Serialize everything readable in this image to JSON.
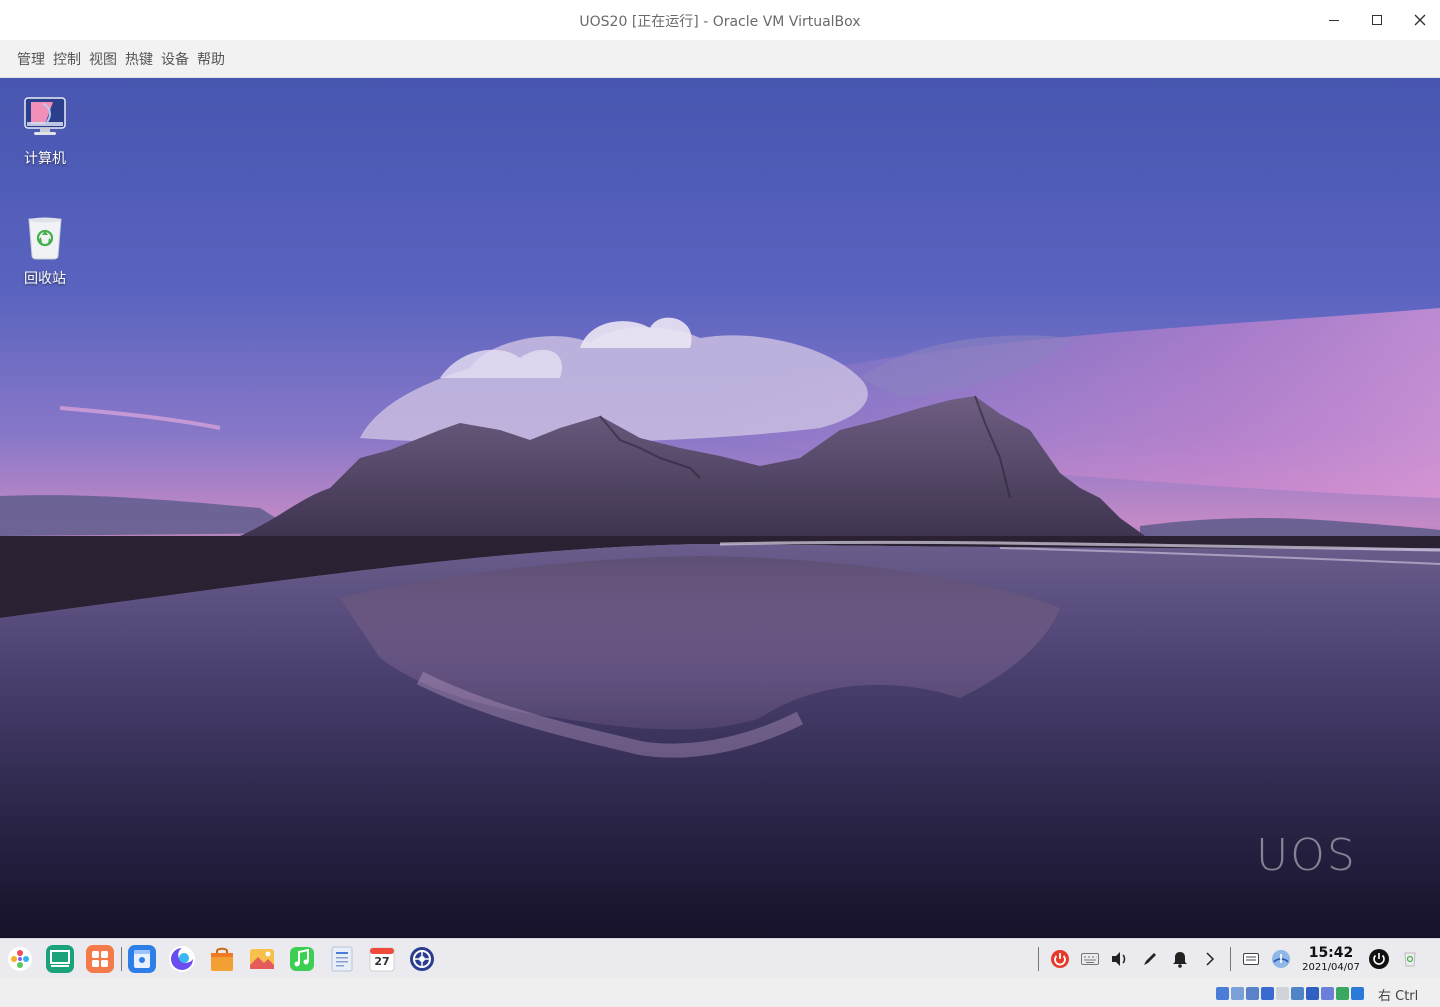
{
  "window": {
    "title": "UOS20 [正在运行] - Oracle VM VirtualBox"
  },
  "menu": {
    "items": [
      "管理",
      "控制",
      "视图",
      "热键",
      "设备",
      "帮助"
    ]
  },
  "desktop": {
    "icons": [
      {
        "label": "计算机",
        "icon": "computer-icon"
      },
      {
        "label": "回收站",
        "icon": "trash-icon"
      }
    ],
    "watermark": "UOS"
  },
  "dock": {
    "apps": [
      {
        "name": "launcher",
        "icon": "launcher-icon",
        "color": "#ffffff"
      },
      {
        "name": "multitask-view",
        "icon": "multitask-view-icon",
        "color": "#1aa37a"
      },
      {
        "name": "app-store",
        "icon": "app-store-icon",
        "color": "#f47a4a"
      },
      {
        "name": "file-manager",
        "icon": "file-manager-icon",
        "color": "#2d7ee6"
      },
      {
        "name": "browser",
        "icon": "browser-icon",
        "color": "#6a4cf0"
      },
      {
        "name": "app-store-bag",
        "icon": "shopping-bag-icon",
        "color": "#f2a033"
      },
      {
        "name": "image-viewer",
        "icon": "image-viewer-icon",
        "color": "#e55a5a"
      },
      {
        "name": "music",
        "icon": "music-icon",
        "color": "#3ccf52"
      },
      {
        "name": "document-viewer",
        "icon": "document-icon",
        "color": "#e8eef8"
      },
      {
        "name": "calendar",
        "icon": "calendar-icon",
        "color": "#ffffff"
      },
      {
        "name": "control-center",
        "icon": "control-center-icon",
        "color": "#2a3d8f"
      }
    ],
    "calendar_day": "27",
    "tray": {
      "icons": [
        "power-app-icon",
        "keyboard-icon",
        "volume-icon",
        "pen-icon",
        "bell-icon",
        "chevron-right-icon",
        "input-method-icon",
        "network-icon"
      ],
      "time": "15:42",
      "date": "2021/04/07"
    }
  },
  "statusbar": {
    "host_key": "右 Ctrl",
    "icons": [
      "hard-disk-icon",
      "optical-drive-icon",
      "audio-icon",
      "network-adapter-icon",
      "usb-icon",
      "shared-folder-icon",
      "display-icon",
      "video-capture-icon",
      "cpu-icon",
      "mouse-integration-icon"
    ]
  },
  "colors": {
    "titlebar_bg": "#ffffff",
    "menubar_bg": "#f2f2f2",
    "dock_bg": "#e9e9ee",
    "sky_top": "#4a5ab5",
    "sky_pink": "#d78ac8"
  }
}
